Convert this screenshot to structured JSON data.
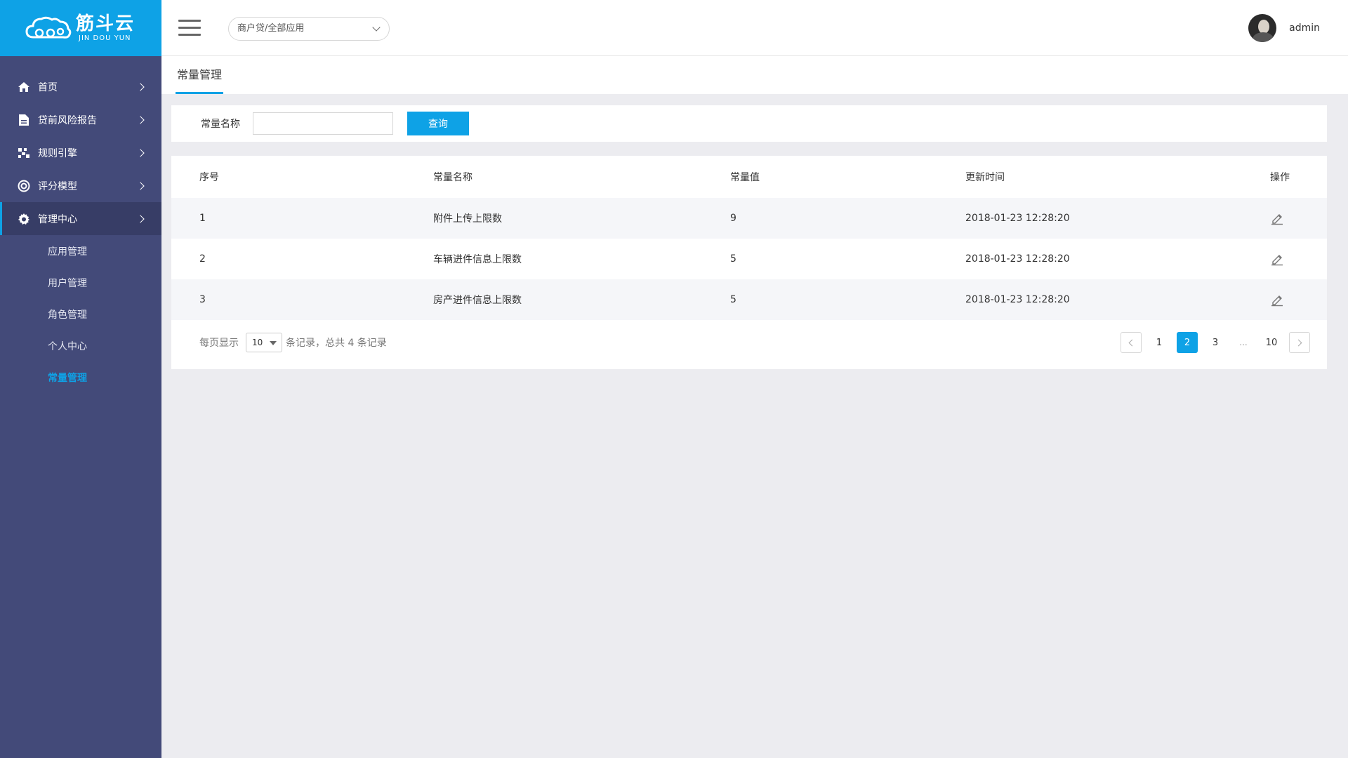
{
  "brand": {
    "name_cn": "筋斗云",
    "name_en": "JIN DOU YUN"
  },
  "header": {
    "app_selector": "商户贷/全部应用",
    "username": "admin"
  },
  "sidebar": {
    "items": [
      {
        "label": "首页",
        "icon": "home-icon"
      },
      {
        "label": "贷前风险报告",
        "icon": "document-icon"
      },
      {
        "label": "规则引擎",
        "icon": "rules-icon"
      },
      {
        "label": "评分模型",
        "icon": "target-icon"
      },
      {
        "label": "管理中心",
        "icon": "gear-icon",
        "active": true
      }
    ],
    "subitems": [
      {
        "label": "应用管理"
      },
      {
        "label": "用户管理"
      },
      {
        "label": "角色管理"
      },
      {
        "label": "个人中心"
      },
      {
        "label": "常量管理",
        "current": true
      }
    ]
  },
  "tab": {
    "label": "常量管理"
  },
  "search": {
    "label": "常量名称",
    "value": "",
    "button": "查询"
  },
  "table": {
    "columns": [
      "序号",
      "常量名称",
      "常量值",
      "更新时间",
      "操作"
    ],
    "rows": [
      {
        "index": "1",
        "name": "附件上传上限数",
        "value": "9",
        "updated": "2018-01-23 12:28:20"
      },
      {
        "index": "2",
        "name": "车辆进件信息上限数",
        "value": "5",
        "updated": "2018-01-23 12:28:20"
      },
      {
        "index": "3",
        "name": "房产进件信息上限数",
        "value": "5",
        "updated": "2018-01-23 12:28:20"
      }
    ]
  },
  "pagination": {
    "prefix": "每页显示",
    "page_size": "10",
    "suffix": "条记录，总共 4 条记录",
    "pages": [
      "1",
      "2",
      "3"
    ],
    "ellipsis": "...",
    "last": "10",
    "current": "2"
  },
  "colors": {
    "accent": "#0ea2e6",
    "sidebar": "#434a79",
    "sidebar_active": "#373d66"
  }
}
